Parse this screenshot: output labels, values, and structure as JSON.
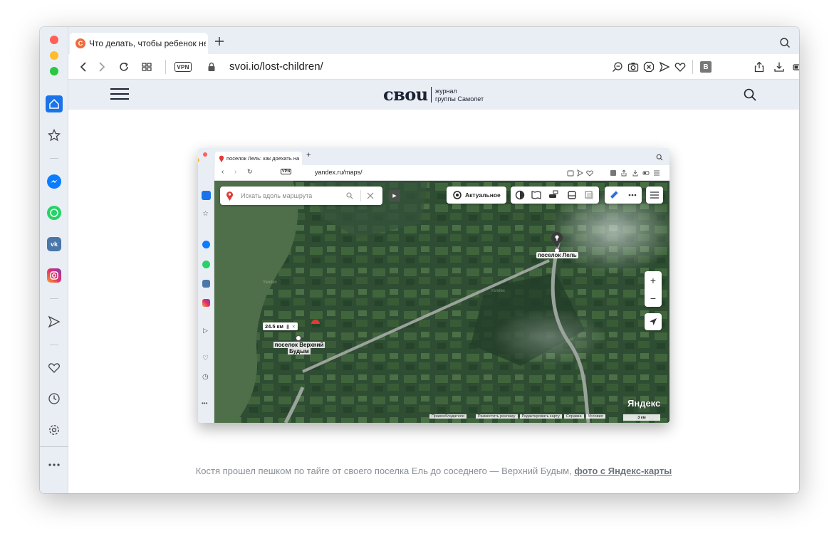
{
  "browser": {
    "tab": {
      "title": "Что делать, чтобы ребенок не",
      "favicon_letter": "С"
    },
    "address": {
      "vpn_label": "VPN",
      "url": "svoi.io/lost-children/"
    }
  },
  "site": {
    "logo": "своu",
    "logo_sub_line1": "журнал",
    "logo_sub_line2": "группы Самолет"
  },
  "screenshot": {
    "tab_title": "поселок Лель: как доехать на",
    "vpn_label": "VPN",
    "url": "yandex.ru/maps/",
    "search_placeholder": "Искать вдоль маршрута",
    "actual_label": "Актуальное",
    "place_lel": "поселок Лель",
    "place_verkhniy_1": "поселок Верхний",
    "place_verkhniy_2": "Будым",
    "distance": "24.5 км",
    "watermark": "Яндекс",
    "map_label_1": "Yandex",
    "map_label_2": "Yandex",
    "footer": [
      "Правообладатели",
      "Разместить рекламу",
      "Редактировать карту",
      "Справка",
      "Условия"
    ],
    "scale": "3 км",
    "zoom_in": "+",
    "zoom_out": "−"
  },
  "caption": {
    "text": "Костя прошел пешком по тайге от своего поселка Ель до соседнего — Верхний Будым, ",
    "link": "фото с Яндекс-карты"
  },
  "colors": {
    "accent": "#1a73e8",
    "header_bg": "#e9eef5",
    "caption": "#8a8f96"
  }
}
